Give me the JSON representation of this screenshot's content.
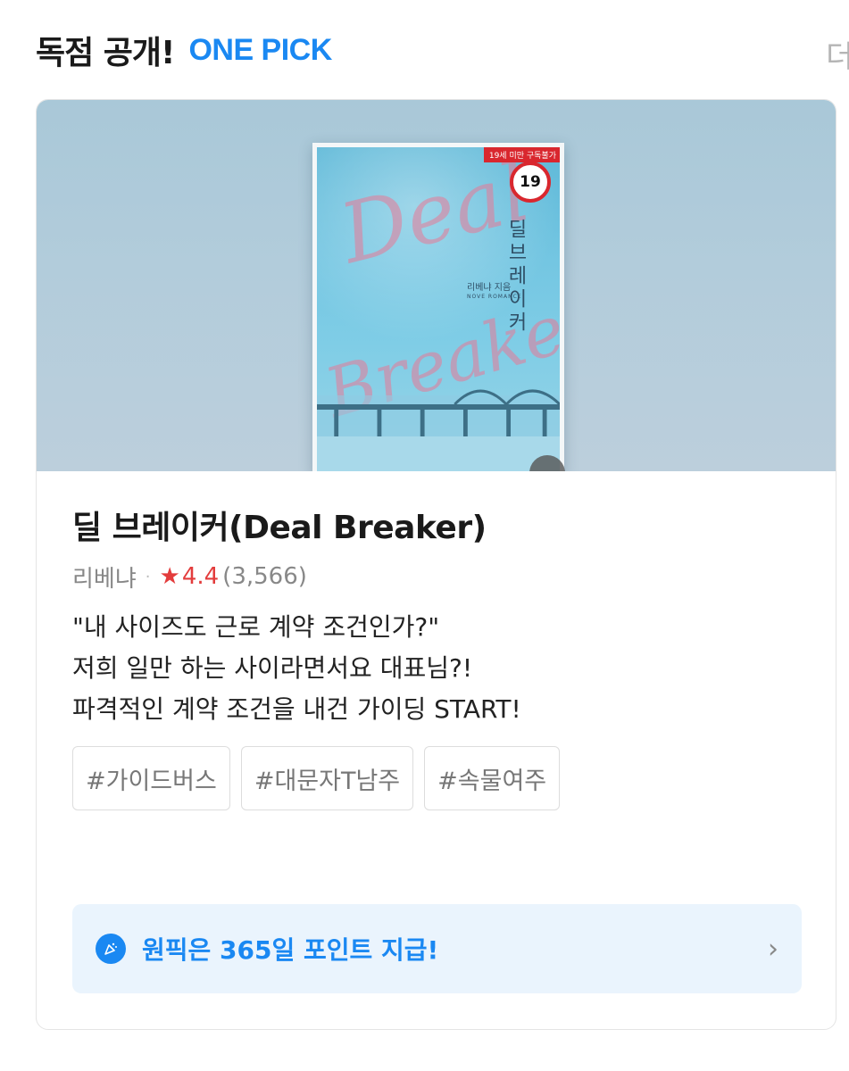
{
  "header": {
    "title": "독점 공개!",
    "brand": "ONE PICK",
    "more": "더보기"
  },
  "cover": {
    "age_ribbon": "19세 미만 구독불가",
    "age_badge": "19",
    "script_top": "Deal",
    "script_bottom": "Breaker",
    "vertical_title": "딜브레이커",
    "author_line": "리베냐 지음",
    "sub_line": "NOVE ROMANCE"
  },
  "book": {
    "title": "딜 브레이커(Deal Breaker)",
    "author": "리베냐",
    "separator": "·",
    "rating": "4.4",
    "review_count": "(3,566)",
    "description": [
      "\"내 사이즈도 근로 계약 조건인가?\"",
      "저희 일만 하는 사이라면서요 대표님?!",
      "파격적인 계약 조건을 내건 가이딩 START!"
    ],
    "tags": [
      "#가이드버스",
      "#대문자T남주",
      "#속물여주"
    ]
  },
  "promo": {
    "icon": "party-popper-icon",
    "text": "원픽은 365일 포인트 지급!",
    "chevron": "›"
  },
  "colors": {
    "brand": "#1a88f2",
    "rating": "#e33c3c",
    "promo_bg": "#eaf4fd"
  }
}
